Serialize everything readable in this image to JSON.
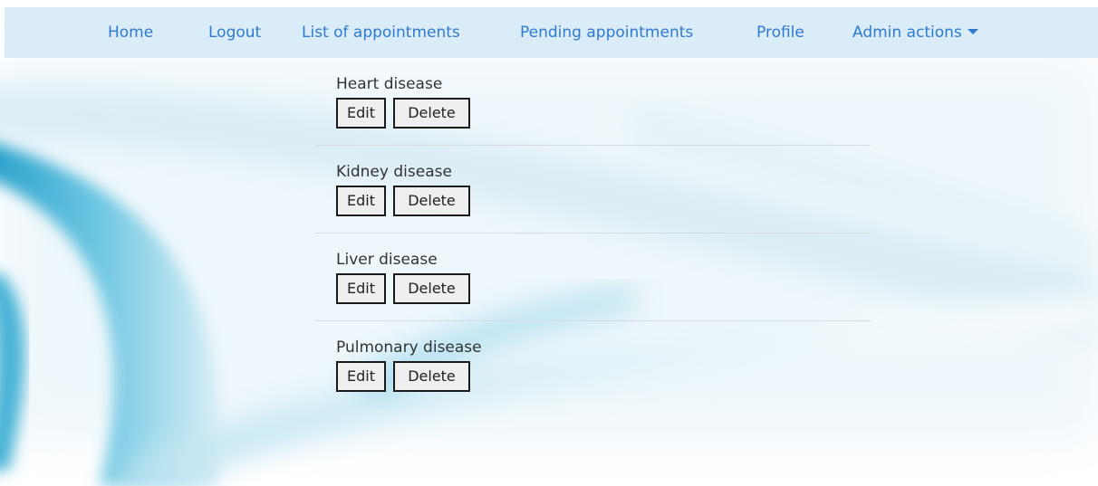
{
  "nav": {
    "home": "Home",
    "logout": "Logout",
    "appointments": "List of appointments",
    "pending": "Pending appointments",
    "profile": "Profile",
    "admin": "Admin actions"
  },
  "diseases": [
    {
      "name": "Heart disease",
      "edit_label": "Edit",
      "delete_label": "Delete"
    },
    {
      "name": "Kidney disease",
      "edit_label": "Edit",
      "delete_label": "Delete"
    },
    {
      "name": "Liver disease",
      "edit_label": "Edit",
      "delete_label": "Delete"
    },
    {
      "name": "Pulmonary disease",
      "edit_label": "Edit",
      "delete_label": "Delete"
    }
  ],
  "colors": {
    "nav_background": "#d9ecf7",
    "nav_link": "#2f7ad1",
    "accent_blue": "#2aa6cf"
  },
  "icons": {
    "admin_dropdown": "caret-down-icon"
  }
}
